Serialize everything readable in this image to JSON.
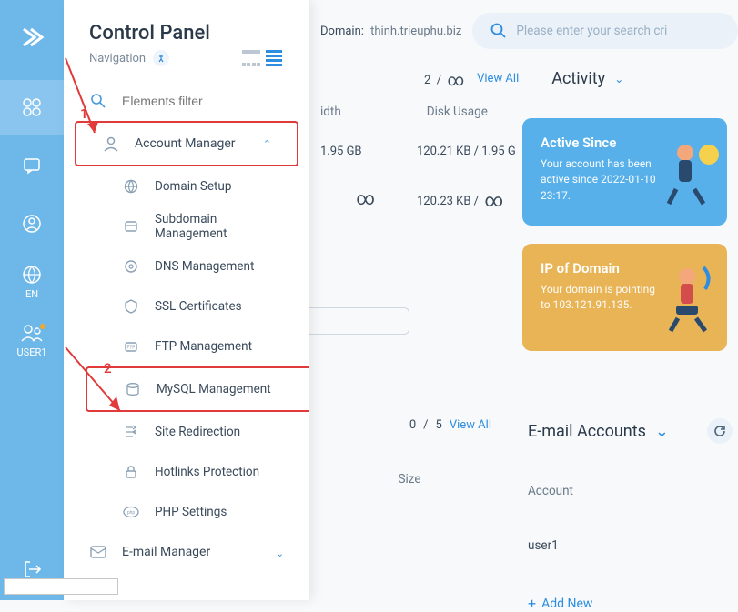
{
  "rail": {
    "lang": "EN",
    "user": "USER1"
  },
  "nav": {
    "title": "Control Panel",
    "subtitle": "Navigation",
    "filter_placeholder": "Elements filter",
    "account_manager": "Account Manager",
    "items": {
      "domain": "Domain Setup",
      "subdomain": "Subdomain Management",
      "dns": "DNS Management",
      "ssl": "SSL Certificates",
      "ftp": "FTP Management",
      "mysql": "MySQL Management",
      "redir": "Site Redirection",
      "hotlink": "Hotlinks Protection",
      "php": "PHP Settings",
      "email": "E-mail Manager"
    }
  },
  "header": {
    "domain_label": "Domain:",
    "domain_value": "thinh.trieuphu.biz",
    "search_placeholder": "Please enter your search cri"
  },
  "counts1": {
    "current": "2",
    "sep": "/",
    "total": "∞",
    "viewall": "View All"
  },
  "activity_title": "Activity",
  "cols": {
    "bw": "idth",
    "disk": "Disk Usage"
  },
  "rows": {
    "r1_bw": "1.95 GB",
    "r1_disk": "120.21 KB  /  1.95 G",
    "r2_bw": "∞",
    "r2_disk_val": "120.23 KB  /",
    "r2_disk_inf": "∞"
  },
  "cards": {
    "blue_title": "Active Since",
    "blue_body": "Your account has been active since 2022-01-10 23:17.",
    "orange_title": "IP of Domain",
    "orange_body": "Your domain is pointing to 103.121.91.135."
  },
  "counts2": {
    "current": "0",
    "sep": "/",
    "total": "5",
    "viewall": "View All"
  },
  "email_title": "E-mail Accounts",
  "th_size": "Size",
  "th_account": "Account",
  "email_user": "user1",
  "addnew": "Add New",
  "anno": {
    "n1": "1",
    "n2": "2"
  }
}
